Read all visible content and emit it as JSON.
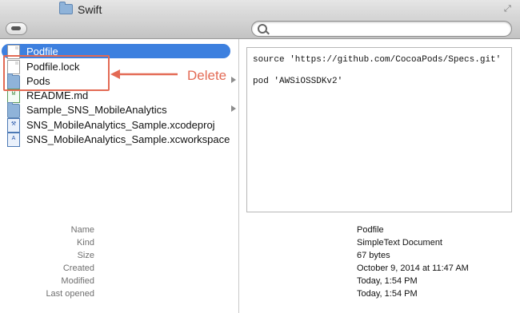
{
  "window": {
    "title": "Swift"
  },
  "search": {
    "placeholder": ""
  },
  "files": [
    {
      "name": "Podfile",
      "kind": "doc",
      "selected": true,
      "has_children": false
    },
    {
      "name": "Podfile.lock",
      "kind": "doc",
      "selected": false,
      "has_children": false
    },
    {
      "name": "Pods",
      "kind": "folder",
      "selected": false,
      "has_children": true
    },
    {
      "name": "README.md",
      "kind": "md",
      "selected": false,
      "has_children": false
    },
    {
      "name": "Sample_SNS_MobileAnalytics",
      "kind": "folder",
      "selected": false,
      "has_children": true
    },
    {
      "name": "SNS_MobileAnalytics_Sample.xcodeproj",
      "kind": "xc",
      "selected": false,
      "has_children": false
    },
    {
      "name": "SNS_MobileAnalytics_Sample.xcworkspace",
      "kind": "xc",
      "selected": false,
      "has_children": false
    }
  ],
  "annotation": {
    "label": "Delete",
    "color": "#e36a54"
  },
  "preview": {
    "lines": [
      "source 'https://github.com/CocoaPods/Specs.git'",
      "",
      "pod 'AWSiOSSDKv2'"
    ]
  },
  "info": [
    {
      "key": "Name",
      "value": "Podfile"
    },
    {
      "key": "Kind",
      "value": "SimpleText Document"
    },
    {
      "key": "Size",
      "value": "67 bytes"
    },
    {
      "key": "Created",
      "value": "October 9, 2014 at 11:47 AM"
    },
    {
      "key": "Modified",
      "value": "Today, 1:54 PM"
    },
    {
      "key": "Last opened",
      "value": "Today, 1:54 PM"
    }
  ],
  "colors": {
    "selection": "#3d80df",
    "folder": "#8fb3d9"
  }
}
